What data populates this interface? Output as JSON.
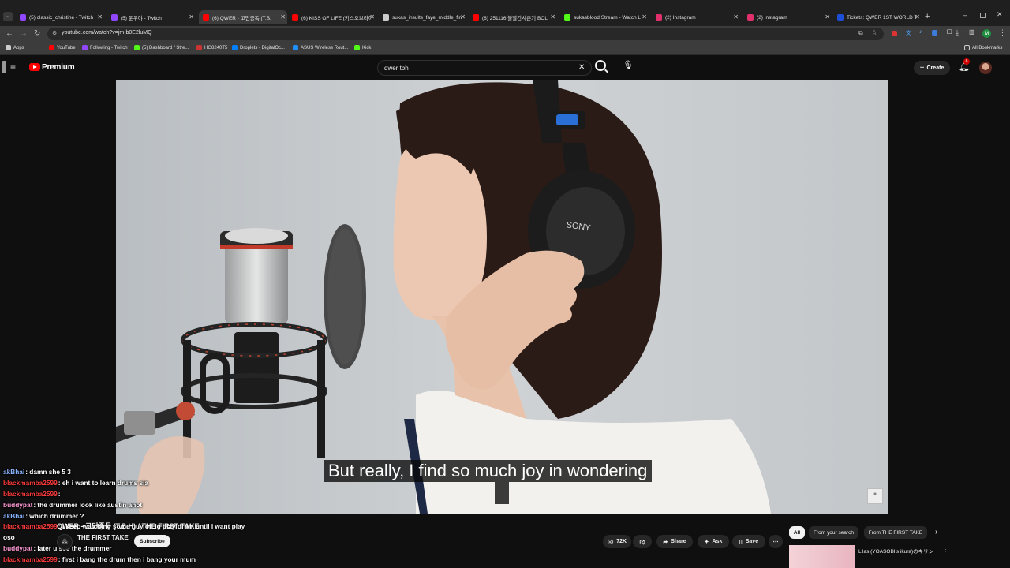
{
  "browser": {
    "tabs": [
      {
        "title": "(5) classic_christine - Twitch",
        "color": "#9146ff"
      },
      {
        "title": "(5) 운우야 - Twitch",
        "color": "#9146ff"
      },
      {
        "title": "(6) QWER - 고민중독 (T.B.",
        "color": "#ff0000",
        "active": true
      },
      {
        "title": "(6) KISS OF LIFE (키스오브라이",
        "color": "#ff0000"
      },
      {
        "title": "sukas_insults_faye_middle_fin",
        "color": "#cccccc"
      },
      {
        "title": "(6) 251116 불빨간사춘기 BOL",
        "color": "#ff0000"
      },
      {
        "title": "sukasblood Stream - Watch L",
        "color": "#53fc18"
      },
      {
        "title": "(2) Instagram",
        "color": "#e1306c"
      },
      {
        "title": "(2) Instagram",
        "color": "#e1306c"
      },
      {
        "title": "Tickets: QWER 1ST WORLD TO",
        "color": "#1d4ed8"
      }
    ],
    "url": "youtube.com/watch?v=jm-b0E2luMQ",
    "bookmarks": [
      {
        "label": "Apps",
        "color": "#cccccc"
      },
      {
        "label": "YouTube",
        "color": "#ff0000"
      },
      {
        "label": "Following - Twitch",
        "color": "#9146ff"
      },
      {
        "label": "(5) Dashboard / Stre...",
        "color": "#53fc18"
      },
      {
        "label": "HG8240T5",
        "color": "#cc3333"
      },
      {
        "label": "Droplets - DigitalOc...",
        "color": "#0080ff"
      },
      {
        "label": "ASUS Wireless Rout...",
        "color": "#1e90ff"
      },
      {
        "label": "Kick",
        "color": "#53fc18"
      }
    ],
    "all_bookmarks": "All Bookmarks",
    "profile_initial": "M"
  },
  "youtube": {
    "logo_text": "Premium",
    "search_query": "qwer tbh",
    "create_label": "Create",
    "notification_count": "6"
  },
  "video": {
    "caption": "But really, I find so much joy in wondering",
    "title": "QWER - 고민중독 (T.B.H) / THE FIRST TAKE",
    "channel": "THE FIRST TAKE",
    "subscribe_label": "Subscribe",
    "likes": "72K",
    "share_label": "Share",
    "ask_label": "Ask",
    "save_label": "Save"
  },
  "chat": [
    {
      "user": "akBhai",
      "user_color": "#89b4ff",
      "msg": "damn she 5 3"
    },
    {
      "user": "blackmamba2599",
      "user_color": "#ff3b3b",
      "msg": "eh i want to learn drums sia"
    },
    {
      "user": "blackmamba2599",
      "user_color": "#ff3b3b",
      "msg": ""
    },
    {
      "user": "buddypat",
      "user_color": "#ff9ad5",
      "msg": "the drummer look like austin anot"
    },
    {
      "user": "akBhai",
      "user_color": "#89b4ff",
      "msg": "which drummer ?"
    },
    {
      "user": "blackmamba2599",
      "user_color": "#ff3b3b",
      "msg": "i keep watching some guy on ig play drum until i want play"
    },
    {
      "user": "",
      "user_color": "#ffffff",
      "msg": "oso"
    },
    {
      "user": "buddypat",
      "user_color": "#ff9ad5",
      "msg": "later u see the drummer"
    },
    {
      "user": "blackmamba2599",
      "user_color": "#ff3b3b",
      "msg": "first i bang the drum then i bang your mum"
    }
  ],
  "recommendations": {
    "chips": [
      "All",
      "From your search",
      "From THE FIRST TAKE"
    ],
    "first_item": "Lilas (YOASOBI's ikura)のキリン"
  },
  "colors": {
    "yt_red": "#ff0000",
    "bg": "#0f0f0f"
  }
}
